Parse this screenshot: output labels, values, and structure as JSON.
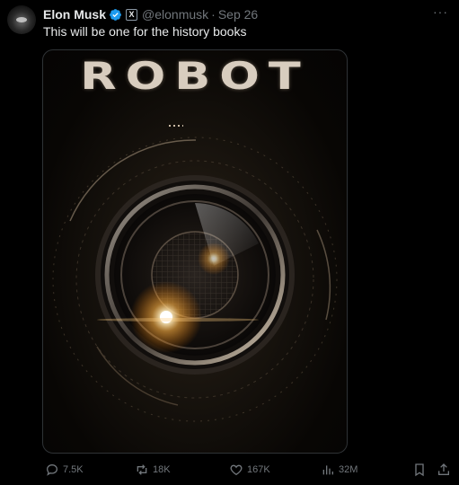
{
  "tweet": {
    "author": {
      "name": "Elon Musk",
      "handle": "@elonmusk",
      "verified": true,
      "affiliation_badge": "X"
    },
    "separator": "·",
    "date": "Sep 26",
    "more_label": "···",
    "text": "This will be one for the history books",
    "media": {
      "poster_title": "ROBOT"
    },
    "actions": {
      "replies": "7.5K",
      "reposts": "18K",
      "likes": "167K",
      "views": "32M"
    }
  },
  "colors": {
    "background": "#000000",
    "text_primary": "#e7e9ea",
    "text_secondary": "#71767b",
    "verified_blue": "#1d9bf0",
    "border": "#2f3336"
  }
}
